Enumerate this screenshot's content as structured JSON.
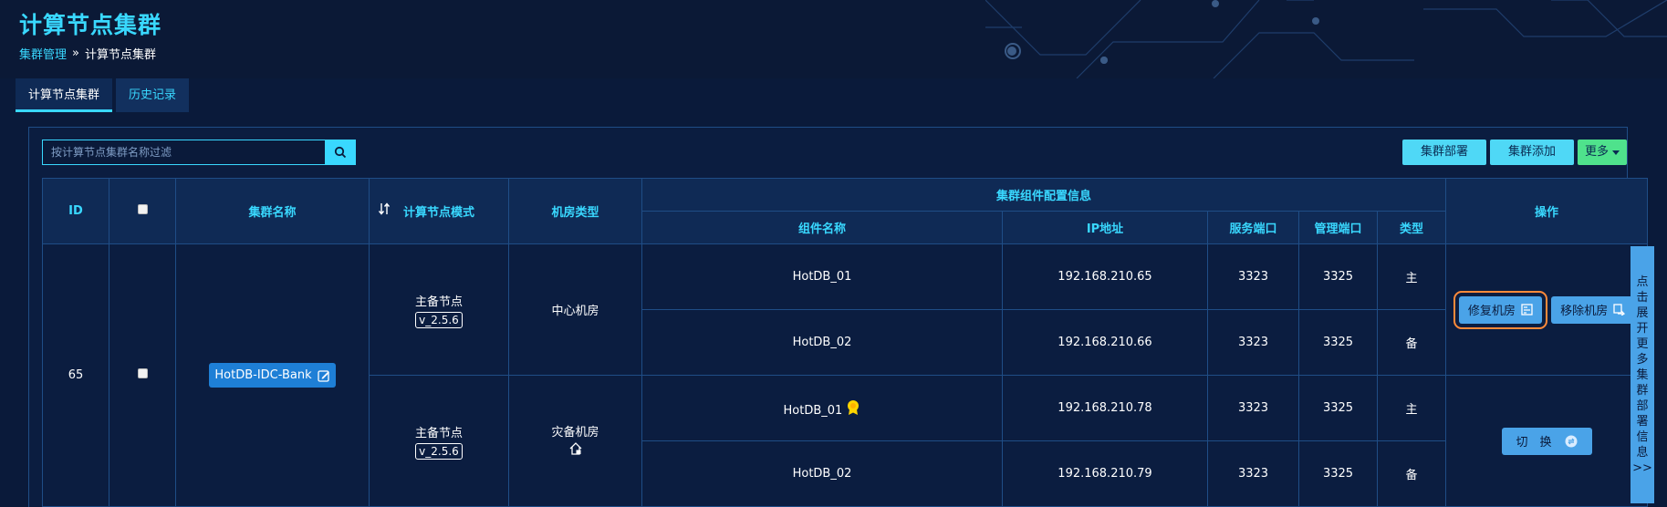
{
  "page": {
    "title": "计算节点集群",
    "breadcrumb": {
      "parent": "集群管理",
      "separator": "»",
      "current": "计算节点集群"
    }
  },
  "tabs": [
    {
      "label": "计算节点集群",
      "active": true
    },
    {
      "label": "历史记录",
      "active": false
    }
  ],
  "search": {
    "placeholder": "按计算节点集群名称过滤",
    "icon": "search-icon"
  },
  "toolbar": {
    "deploy_label": "集群部署",
    "add_label": "集群添加",
    "more_label": "更多"
  },
  "table": {
    "headers": {
      "id": "ID",
      "name": "集群名称",
      "mode": "计算节点模式",
      "room_type": "机房类型",
      "component_group": "集群组件配置信息",
      "operation": "操作",
      "component_name": "组件名称",
      "ip": "IP地址",
      "service_port": "服务端口",
      "manage_port": "管理端口",
      "type": "类型"
    },
    "cluster": {
      "id": "65",
      "name": "HotDB-IDC-Bank",
      "groups": [
        {
          "mode": "主备节点",
          "version": "v_2.5.6",
          "room": "中心机房",
          "rows": [
            {
              "component": "HotDB_01",
              "ip": "192.168.210.65",
              "service_port": "3323",
              "manage_port": "3325",
              "type": "主"
            },
            {
              "component": "HotDB_02",
              "ip": "192.168.210.66",
              "service_port": "3323",
              "manage_port": "3325",
              "type": "备"
            }
          ]
        },
        {
          "mode": "主备节点",
          "version": "v_2.5.6",
          "room": "灾备机房",
          "rows": [
            {
              "component": "HotDB_01",
              "ip": "192.168.210.78",
              "service_port": "3323",
              "manage_port": "3325",
              "type": "主"
            },
            {
              "component": "HotDB_02",
              "ip": "192.168.210.79",
              "service_port": "3323",
              "manage_port": "3325",
              "type": "备"
            }
          ]
        }
      ]
    },
    "operations": {
      "repair_label": "修复机房",
      "remove_label": "移除机房",
      "switch_label": "切　换"
    }
  },
  "side_tab": {
    "chars": [
      "点",
      "击",
      "展",
      "开",
      "更",
      "多",
      "集",
      "群",
      "部",
      "署",
      "信",
      "息",
      ">>"
    ]
  },
  "colors": {
    "accent": "#39d8ff",
    "green": "#4fe28c",
    "highlight": "#ff8a3a",
    "button_blue": "#4aa3e8"
  }
}
